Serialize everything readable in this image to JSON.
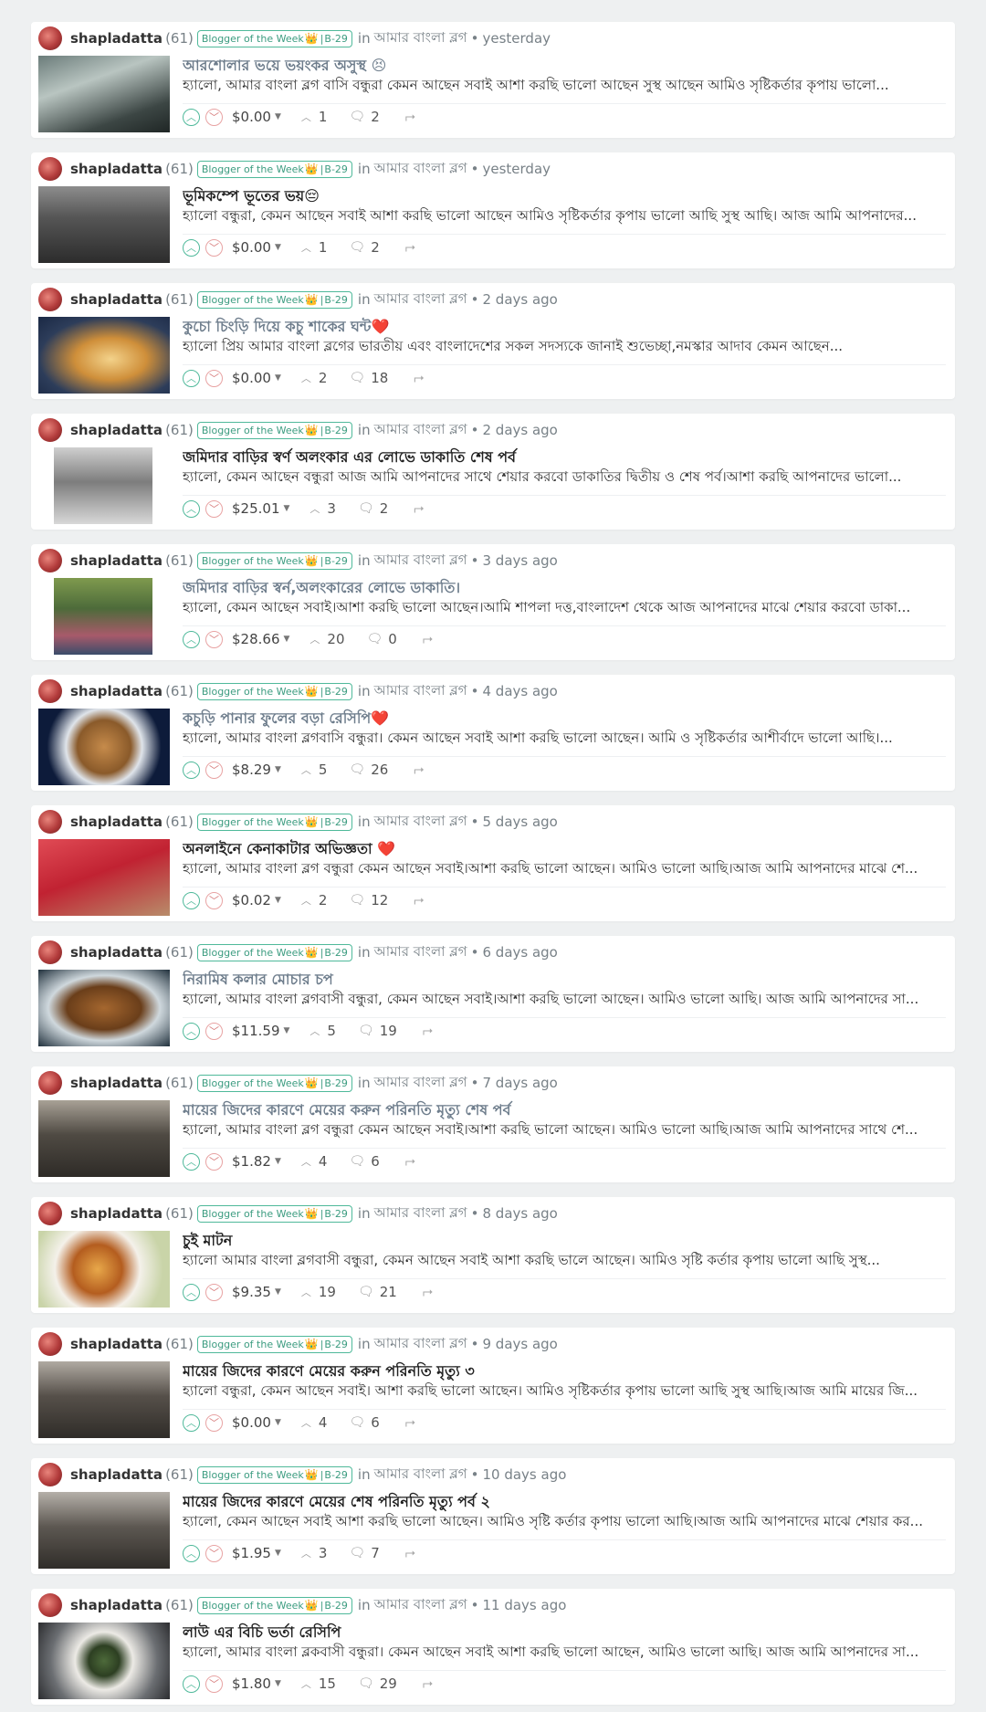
{
  "colors": {
    "accent": "#4fb99a",
    "downvote": "#d67979",
    "meta": "#788187",
    "background": "#eef0f1"
  },
  "icons": {
    "upvote": "chevron-up-circle-icon",
    "downvote": "chevron-down-circle-icon",
    "payout_caret": "caret-down-icon",
    "votes": "chevron-up-icon",
    "comments": "comment-bubble-icon",
    "reblog": "reblog-icon"
  },
  "posts": [
    {
      "author": "shapladatta",
      "reputation": "(61)",
      "badge_left": "Blogger of the Week",
      "badge_crown": "👑",
      "badge_sep": "|",
      "badge_right": "B-29",
      "in": "in",
      "community": "আমার বাংলা ব্লগ",
      "dot": "•",
      "time": "yesterday",
      "title": "আরশোলার ভয়ে ভয়ংকর অসুস্থ 😣",
      "summary": "হ্যালো, আমার বাংলা ব্লগ বাসি বন্ধুরা কেমন আছেন সবাই আশা করছি ভালো আছেন সুস্থ আছেন আমিও সৃষ্টিকর্তার কৃপায় ভালো...",
      "payout": "$0.00",
      "votes": "1",
      "comments": "2",
      "visited": true
    },
    {
      "author": "shapladatta",
      "reputation": "(61)",
      "badge_left": "Blogger of the Week",
      "badge_crown": "👑",
      "badge_sep": "|",
      "badge_right": "B-29",
      "in": "in",
      "community": "আমার বাংলা ব্লগ",
      "dot": "•",
      "time": "yesterday",
      "title": "ভূমিকম্পে ভূতের ভয়😔",
      "summary": "হ্যালো বন্ধুরা, কেমন আছেন সবাই আশা করছি ভালো আছেন আমিও সৃষ্টিকর্তার কৃপায় ভালো আছি সুস্থ আছি। আজ আমি আপনাদের...",
      "payout": "$0.00",
      "votes": "1",
      "comments": "2",
      "visited": false
    },
    {
      "author": "shapladatta",
      "reputation": "(61)",
      "badge_left": "Blogger of the Week",
      "badge_crown": "👑",
      "badge_sep": "|",
      "badge_right": "B-29",
      "in": "in",
      "community": "আমার বাংলা ব্লগ",
      "dot": "•",
      "time": "2 days ago",
      "title": "কুচো চিংড়ি দিয়ে কচু শাকের ঘন্ট❤️",
      "summary": "হ্যালো প্রিয় আমার বাংলা ব্লগের ভারতীয় এবং বাংলাদেশের সকল সদস্যকে জানাই শুভেচ্ছা,নমস্কার আদাব কেমন আছেন...",
      "payout": "$0.00",
      "votes": "2",
      "comments": "18",
      "visited": true
    },
    {
      "author": "shapladatta",
      "reputation": "(61)",
      "badge_left": "Blogger of the Week",
      "badge_crown": "👑",
      "badge_sep": "|",
      "badge_right": "B-29",
      "in": "in",
      "community": "আমার বাংলা ব্লগ",
      "dot": "•",
      "time": "2 days ago",
      "title": "জমিদার বাড়ির স্বর্ণ অলংকার এর লোভে ডাকাতি শেষ পর্ব",
      "summary": "হ্যালো, কেমন আছেন বন্ধুরা আজ আমি আপনাদের সাথে শেয়ার করবো ডাকাতির দ্বিতীয় ও শেষ পর্ব।আশা করছি আপনাদের ভালো...",
      "payout": "$25.01",
      "votes": "3",
      "comments": "2",
      "visited": false
    },
    {
      "author": "shapladatta",
      "reputation": "(61)",
      "badge_left": "Blogger of the Week",
      "badge_crown": "👑",
      "badge_sep": "|",
      "badge_right": "B-29",
      "in": "in",
      "community": "আমার বাংলা ব্লগ",
      "dot": "•",
      "time": "3 days ago",
      "title": "জমিদার বাড়ির স্বর্ন,অলংকারের লোভে ডাকাতি।",
      "summary": "হ্যালো, কেমন আছেন সবাই।আশা করছি ভালো আছেন।আমি শাপলা দত্ত,বাংলাদেশ থেকে আজ আপনাদের মাঝে শেয়ার করবো ডাকা...",
      "payout": "$28.66",
      "votes": "20",
      "comments": "0",
      "visited": true
    },
    {
      "author": "shapladatta",
      "reputation": "(61)",
      "badge_left": "Blogger of the Week",
      "badge_crown": "👑",
      "badge_sep": "|",
      "badge_right": "B-29",
      "in": "in",
      "community": "আমার বাংলা ব্লগ",
      "dot": "•",
      "time": "4 days ago",
      "title": "কচুড়ি পানার ফুলের বড়া রেসিপি❤️",
      "summary": "হ্যালো, আমার বাংলা ব্লগবাসি বন্ধুরা। কেমন আছেন সবাই আশা করছি ভালো আছেন। আমি ও সৃষ্টিকর্তার আশীর্বাদে ভালো আছি।...",
      "payout": "$8.29",
      "votes": "5",
      "comments": "26",
      "visited": true
    },
    {
      "author": "shapladatta",
      "reputation": "(61)",
      "badge_left": "Blogger of the Week",
      "badge_crown": "👑",
      "badge_sep": "|",
      "badge_right": "B-29",
      "in": "in",
      "community": "আমার বাংলা ব্লগ",
      "dot": "•",
      "time": "5 days ago",
      "title": "অনলাইনে কেনাকাটার অভিজ্ঞতা ❤️",
      "summary": "হ্যালো, আমার বাংলা ব্লগ বন্ধুরা কেমন আছেন সবাই।আশা করছি ভালো আছেন। আমিও ভালো আছি।আজ আমি আপনাদের মাঝে শে...",
      "payout": "$0.02",
      "votes": "2",
      "comments": "12",
      "visited": false
    },
    {
      "author": "shapladatta",
      "reputation": "(61)",
      "badge_left": "Blogger of the Week",
      "badge_crown": "👑",
      "badge_sep": "|",
      "badge_right": "B-29",
      "in": "in",
      "community": "আমার বাংলা ব্লগ",
      "dot": "•",
      "time": "6 days ago",
      "title": "নিরামিষ কলার মোচার চপ",
      "summary": "হ্যালো, আমার বাংলা ব্লগবাসী বন্ধুরা, কেমন আছেন সবাই।আশা করছি ভালো আছেন। আমিও ভালো আছি। আজ আমি আপনাদের সা...",
      "payout": "$11.59",
      "votes": "5",
      "comments": "19",
      "visited": true
    },
    {
      "author": "shapladatta",
      "reputation": "(61)",
      "badge_left": "Blogger of the Week",
      "badge_crown": "👑",
      "badge_sep": "|",
      "badge_right": "B-29",
      "in": "in",
      "community": "আমার বাংলা ব্লগ",
      "dot": "•",
      "time": "7 days ago",
      "title": "মায়ের জিদের কারণে মেয়ের করুন পরিনতি মৃত্যু শেষ পর্ব",
      "summary": "হ্যালো, আমার বাংলা ব্লগ বন্ধুরা কেমন আছেন সবাই।আশা করছি ভালো আছেন। আমিও ভালো আছি।আজ আমি আপনাদের সাথে শে...",
      "payout": "$1.82",
      "votes": "4",
      "comments": "6",
      "visited": true
    },
    {
      "author": "shapladatta",
      "reputation": "(61)",
      "badge_left": "Blogger of the Week",
      "badge_crown": "👑",
      "badge_sep": "|",
      "badge_right": "B-29",
      "in": "in",
      "community": "আমার বাংলা ব্লগ",
      "dot": "•",
      "time": "8 days ago",
      "title": "চুই মাটন",
      "summary": "হ্যালো আমার বাংলা ব্লগবাসী বন্ধুরা, কেমন আছেন সবাই আশা করছি ভালে আছেন। আমিও সৃষ্টি কর্তার কৃপায় ভালো আছি সুস্থ...",
      "payout": "$9.35",
      "votes": "19",
      "comments": "21",
      "visited": false
    },
    {
      "author": "shapladatta",
      "reputation": "(61)",
      "badge_left": "Blogger of the Week",
      "badge_crown": "👑",
      "badge_sep": "|",
      "badge_right": "B-29",
      "in": "in",
      "community": "আমার বাংলা ব্লগ",
      "dot": "•",
      "time": "9 days ago",
      "title": "মায়ের জিদের কারণে মেয়ের করুন পরিনতি মৃত্যু ৩",
      "summary": "হ্যালো বন্ধুরা, কেমন আছেন সবাই। আশা করছি ভালো আছেন। আমিও সৃষ্টিকর্তার কৃপায় ভালো আছি সুস্থ আছি।আজ আমি মায়ের জি...",
      "payout": "$0.00",
      "votes": "4",
      "comments": "6",
      "visited": false
    },
    {
      "author": "shapladatta",
      "reputation": "(61)",
      "badge_left": "Blogger of the Week",
      "badge_crown": "👑",
      "badge_sep": "|",
      "badge_right": "B-29",
      "in": "in",
      "community": "আমার বাংলা ব্লগ",
      "dot": "•",
      "time": "10 days ago",
      "title": "মায়ের জিদের কারণে মেয়ের শেষ পরিনতি মৃত্যু পর্ব ২",
      "summary": "হ্যালো, কেমন আছেন সবাই আশা করছি ভালো আছেন। আমিও সৃষ্টি কর্তার কৃপায় ভালো আছি।আজ আমি আপনাদের মাঝে শেয়ার কর...",
      "payout": "$1.95",
      "votes": "3",
      "comments": "7",
      "visited": false
    },
    {
      "author": "shapladatta",
      "reputation": "(61)",
      "badge_left": "Blogger of the Week",
      "badge_crown": "👑",
      "badge_sep": "|",
      "badge_right": "B-29",
      "in": "in",
      "community": "আমার বাংলা ব্লগ",
      "dot": "•",
      "time": "11 days ago",
      "title": "লাউ এর বিচি ভর্তা রেসিপি",
      "summary": "হ্যালো, আমার বাংলা ব্লকবাসী বন্ধুরা। কেমন আছেন সবাই আশা করছি ভালো আছেন, আমিও ভালো আছি। আজ আমি আপনাদের সা...",
      "payout": "$1.80",
      "votes": "15",
      "comments": "29",
      "visited": false
    }
  ]
}
